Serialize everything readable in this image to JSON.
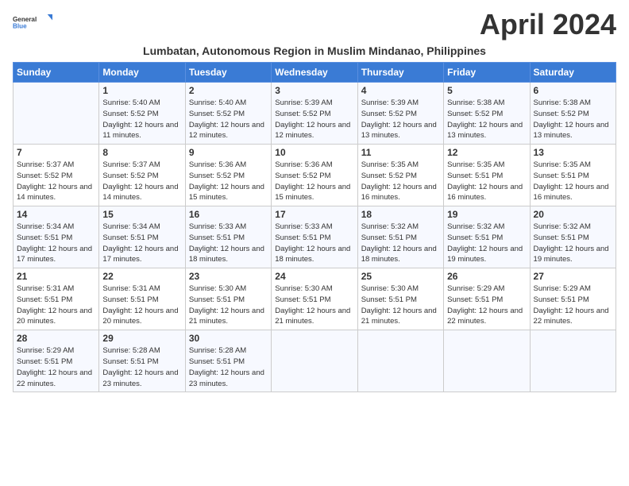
{
  "logo": {
    "general": "General",
    "blue": "Blue"
  },
  "title": "April 2024",
  "location": "Lumbatan, Autonomous Region in Muslim Mindanao, Philippines",
  "days_of_week": [
    "Sunday",
    "Monday",
    "Tuesday",
    "Wednesday",
    "Thursday",
    "Friday",
    "Saturday"
  ],
  "weeks": [
    [
      {
        "day": null
      },
      {
        "day": "1",
        "sunrise": "5:40 AM",
        "sunset": "5:52 PM",
        "daylight": "12 hours and 11 minutes."
      },
      {
        "day": "2",
        "sunrise": "5:40 AM",
        "sunset": "5:52 PM",
        "daylight": "12 hours and 12 minutes."
      },
      {
        "day": "3",
        "sunrise": "5:39 AM",
        "sunset": "5:52 PM",
        "daylight": "12 hours and 12 minutes."
      },
      {
        "day": "4",
        "sunrise": "5:39 AM",
        "sunset": "5:52 PM",
        "daylight": "12 hours and 13 minutes."
      },
      {
        "day": "5",
        "sunrise": "5:38 AM",
        "sunset": "5:52 PM",
        "daylight": "12 hours and 13 minutes."
      },
      {
        "day": "6",
        "sunrise": "5:38 AM",
        "sunset": "5:52 PM",
        "daylight": "12 hours and 13 minutes."
      }
    ],
    [
      {
        "day": "7",
        "sunrise": "5:37 AM",
        "sunset": "5:52 PM",
        "daylight": "12 hours and 14 minutes."
      },
      {
        "day": "8",
        "sunrise": "5:37 AM",
        "sunset": "5:52 PM",
        "daylight": "12 hours and 14 minutes."
      },
      {
        "day": "9",
        "sunrise": "5:36 AM",
        "sunset": "5:52 PM",
        "daylight": "12 hours and 15 minutes."
      },
      {
        "day": "10",
        "sunrise": "5:36 AM",
        "sunset": "5:52 PM",
        "daylight": "12 hours and 15 minutes."
      },
      {
        "day": "11",
        "sunrise": "5:35 AM",
        "sunset": "5:52 PM",
        "daylight": "12 hours and 16 minutes."
      },
      {
        "day": "12",
        "sunrise": "5:35 AM",
        "sunset": "5:51 PM",
        "daylight": "12 hours and 16 minutes."
      },
      {
        "day": "13",
        "sunrise": "5:35 AM",
        "sunset": "5:51 PM",
        "daylight": "12 hours and 16 minutes."
      }
    ],
    [
      {
        "day": "14",
        "sunrise": "5:34 AM",
        "sunset": "5:51 PM",
        "daylight": "12 hours and 17 minutes."
      },
      {
        "day": "15",
        "sunrise": "5:34 AM",
        "sunset": "5:51 PM",
        "daylight": "12 hours and 17 minutes."
      },
      {
        "day": "16",
        "sunrise": "5:33 AM",
        "sunset": "5:51 PM",
        "daylight": "12 hours and 18 minutes."
      },
      {
        "day": "17",
        "sunrise": "5:33 AM",
        "sunset": "5:51 PM",
        "daylight": "12 hours and 18 minutes."
      },
      {
        "day": "18",
        "sunrise": "5:32 AM",
        "sunset": "5:51 PM",
        "daylight": "12 hours and 18 minutes."
      },
      {
        "day": "19",
        "sunrise": "5:32 AM",
        "sunset": "5:51 PM",
        "daylight": "12 hours and 19 minutes."
      },
      {
        "day": "20",
        "sunrise": "5:32 AM",
        "sunset": "5:51 PM",
        "daylight": "12 hours and 19 minutes."
      }
    ],
    [
      {
        "day": "21",
        "sunrise": "5:31 AM",
        "sunset": "5:51 PM",
        "daylight": "12 hours and 20 minutes."
      },
      {
        "day": "22",
        "sunrise": "5:31 AM",
        "sunset": "5:51 PM",
        "daylight": "12 hours and 20 minutes."
      },
      {
        "day": "23",
        "sunrise": "5:30 AM",
        "sunset": "5:51 PM",
        "daylight": "12 hours and 21 minutes."
      },
      {
        "day": "24",
        "sunrise": "5:30 AM",
        "sunset": "5:51 PM",
        "daylight": "12 hours and 21 minutes."
      },
      {
        "day": "25",
        "sunrise": "5:30 AM",
        "sunset": "5:51 PM",
        "daylight": "12 hours and 21 minutes."
      },
      {
        "day": "26",
        "sunrise": "5:29 AM",
        "sunset": "5:51 PM",
        "daylight": "12 hours and 22 minutes."
      },
      {
        "day": "27",
        "sunrise": "5:29 AM",
        "sunset": "5:51 PM",
        "daylight": "12 hours and 22 minutes."
      }
    ],
    [
      {
        "day": "28",
        "sunrise": "5:29 AM",
        "sunset": "5:51 PM",
        "daylight": "12 hours and 22 minutes."
      },
      {
        "day": "29",
        "sunrise": "5:28 AM",
        "sunset": "5:51 PM",
        "daylight": "12 hours and 23 minutes."
      },
      {
        "day": "30",
        "sunrise": "5:28 AM",
        "sunset": "5:51 PM",
        "daylight": "12 hours and 23 minutes."
      },
      {
        "day": null
      },
      {
        "day": null
      },
      {
        "day": null
      },
      {
        "day": null
      }
    ]
  ],
  "sunrise_label": "Sunrise:",
  "sunset_label": "Sunset:",
  "daylight_label": "Daylight:"
}
